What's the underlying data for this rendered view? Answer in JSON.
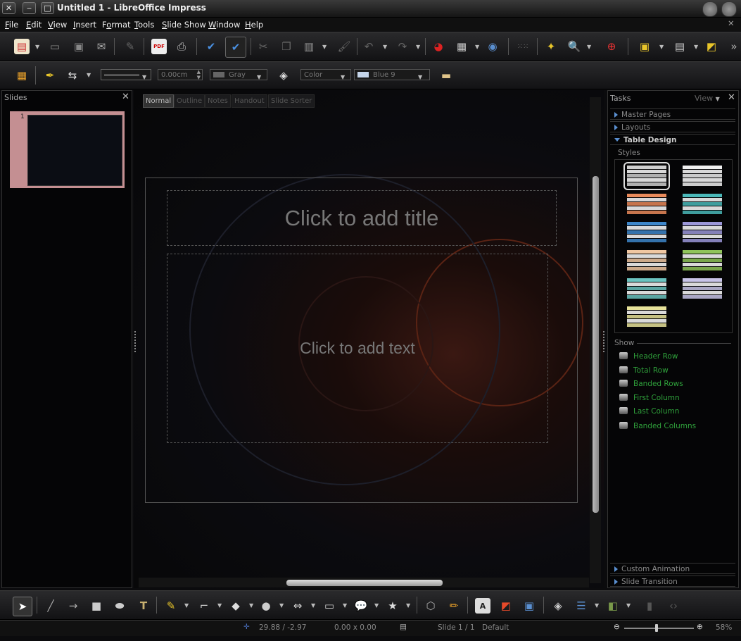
{
  "window": {
    "title": "Untitled 1 - LibreOffice Impress",
    "close_glyph": "✕",
    "minimize_glyph": "‒",
    "maximize_glyph": "□"
  },
  "menu": [
    {
      "label": "File",
      "u": "F",
      "rest": "ile"
    },
    {
      "label": "Edit",
      "u": "E",
      "rest": "dit"
    },
    {
      "label": "View",
      "u": "V",
      "rest": "iew"
    },
    {
      "label": "Insert",
      "u": "I",
      "rest": "nsert"
    },
    {
      "label": "Format",
      "u": "o",
      "pre": "F",
      "rest": "rmat"
    },
    {
      "label": "Tools",
      "u": "T",
      "rest": "ools"
    },
    {
      "label": "Slide Show",
      "u": "S",
      "rest": "lide Show"
    },
    {
      "label": "Window",
      "u": "W",
      "rest": "indow"
    },
    {
      "label": "Help",
      "u": "H",
      "rest": "elp"
    }
  ],
  "line_toolbar": {
    "line_width": "0.00cm",
    "line_color": "Gray",
    "area_style": "Color",
    "area_color": "Blue 9"
  },
  "slides_panel": {
    "title": "Slides",
    "slide_number": "1"
  },
  "view_tabs": [
    "Normal",
    "Outline",
    "Notes",
    "Handout",
    "Slide Sorter"
  ],
  "slide": {
    "title_placeholder": "Click to add title",
    "text_placeholder": "Click to add text"
  },
  "tasks": {
    "title": "Tasks",
    "view_label": "View",
    "sections": [
      "Master Pages",
      "Layouts",
      "Table Design"
    ],
    "styles_label": "Styles",
    "show_label": "Show",
    "show_options": [
      "Header Row",
      "Total Row",
      "Banded Rows",
      "First Column",
      "Last Column",
      "Banded Columns"
    ],
    "bottom_sections": [
      "Custom Animation",
      "Slide Transition"
    ],
    "styles": [
      {
        "name": "default",
        "color": "#cfcfcf"
      },
      {
        "name": "plain",
        "color": "#f0f0f0"
      },
      {
        "name": "orange",
        "color": "#e98a5a"
      },
      {
        "name": "teal",
        "color": "#4ab8b8"
      },
      {
        "name": "blue",
        "color": "#3d86c9"
      },
      {
        "name": "lavender",
        "color": "#9b97d8"
      },
      {
        "name": "peach",
        "color": "#f0c7a2"
      },
      {
        "name": "green",
        "color": "#8fc45a"
      },
      {
        "name": "aqua",
        "color": "#6bc3c0"
      },
      {
        "name": "lilac",
        "color": "#c8c4e8"
      },
      {
        "name": "yellow",
        "color": "#e8e39a"
      }
    ]
  },
  "status": {
    "position": "29.88 / -2.97",
    "size": "0.00 x 0.00",
    "slide": "Slide 1 / 1",
    "layout": "Default",
    "zoom": "58%",
    "zoom_fraction": 0.46
  }
}
